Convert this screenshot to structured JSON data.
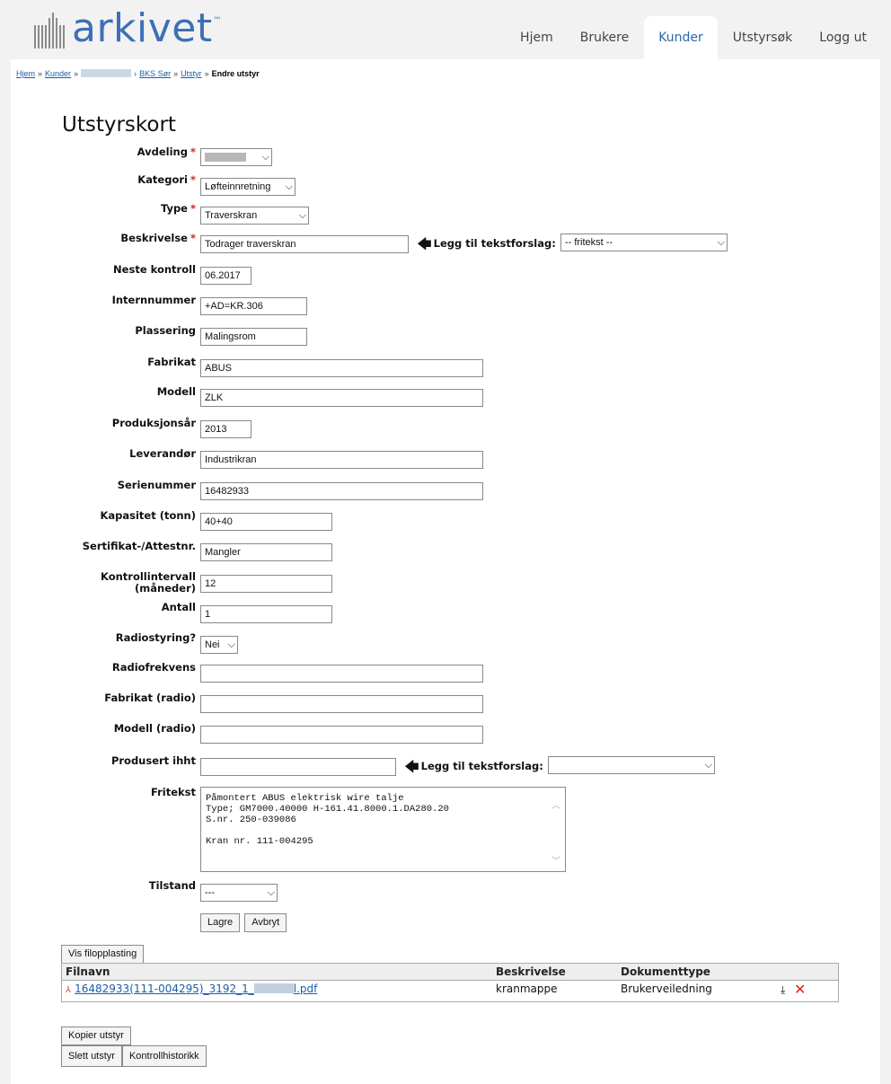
{
  "app": {
    "logo_text": "arkivet",
    "logo_tm": "™"
  },
  "nav": {
    "items": [
      {
        "label": "Hjem"
      },
      {
        "label": "Brukere"
      },
      {
        "label": "Kunder"
      },
      {
        "label": "Utstyrsøk"
      },
      {
        "label": "Logg ut"
      }
    ],
    "active": "Kunder"
  },
  "breadcrumb": {
    "items": [
      "Hjem",
      "Kunder",
      "BKS Sør",
      "Utstyr"
    ],
    "current": "Endre utstyr",
    "separator": "»"
  },
  "page_title": "Utstyrskort",
  "form": {
    "avdeling": {
      "label": "Avdeling",
      "required": "*"
    },
    "kategori": {
      "label": "Kategori",
      "required": "*",
      "value": "Løfteinnretning"
    },
    "type": {
      "label": "Type",
      "required": "*",
      "value": "Traverskran"
    },
    "beskrivelse": {
      "label": "Beskrivelse",
      "required": "*",
      "value": "Todrager traverskran",
      "suggest_label": "Legg til tekstforslag:",
      "suggest_value": "-- fritekst --"
    },
    "neste_kontroll": {
      "label": "Neste kontroll",
      "value": "06.2017"
    },
    "internnummer": {
      "label": "Internnummer",
      "value": "+AD=KR.306"
    },
    "plassering": {
      "label": "Plassering",
      "value": "Malingsrom"
    },
    "fabrikat": {
      "label": "Fabrikat",
      "value": "ABUS"
    },
    "modell": {
      "label": "Modell",
      "value": "ZLK"
    },
    "produksjonsar": {
      "label": "Produksjonsår",
      "value": "2013"
    },
    "leverandor": {
      "label": "Leverandør",
      "value": "Industrikran"
    },
    "serienummer": {
      "label": "Serienummer",
      "value": "16482933"
    },
    "kapasitet": {
      "label": "Kapasitet (tonn)",
      "value": "40+40"
    },
    "sertifikat": {
      "label": "Sertifikat-/Attestnr.",
      "value": "Mangler"
    },
    "kontrollintervall": {
      "label": "Kontrollintervall",
      "label2": "(måneder)",
      "value": "12"
    },
    "antall": {
      "label": "Antall",
      "value": "1"
    },
    "radiostyring": {
      "label": "Radiostyring?",
      "value": "Nei"
    },
    "radiofrekvens": {
      "label": "Radiofrekvens",
      "value": ""
    },
    "fabrikat_radio": {
      "label": "Fabrikat (radio)",
      "value": ""
    },
    "modell_radio": {
      "label": "Modell (radio)",
      "value": ""
    },
    "produsert_ihht": {
      "label": "Produsert ihht",
      "value": "",
      "suggest_label": "Legg til tekstforslag:",
      "suggest_value": ""
    },
    "fritekst": {
      "label": "Fritekst",
      "value": "Påmontert ABUS elektrisk wire talje\nType; GM7000.40000 H-161.41.8000.1.DA280.20\nS.nr. 250-039086\n\nKran nr. 111-004295"
    },
    "tilstand": {
      "label": "Tilstand",
      "value": "---"
    }
  },
  "buttons": {
    "lagre": "Lagre",
    "avbryt": "Avbryt",
    "vis_filopplasting": "Vis filopplasting",
    "kopier_utstyr": "Kopier utstyr",
    "slett_utstyr": "Slett utstyr",
    "kontrollhistorikk": "Kontrollhistorikk"
  },
  "files": {
    "headers": {
      "filnavn": "Filnavn",
      "beskrivelse": "Beskrivelse",
      "dokumenttype": "Dokumenttype"
    },
    "rows": [
      {
        "filnavn_prefix": "16482933(111-004295)_3192_1_",
        "filnavn_suffix": "l.pdf",
        "beskrivelse": "kranmappe",
        "dokumenttype": "Brukerveiledning"
      }
    ]
  },
  "icons": {
    "pdf": "pdf-icon",
    "download": "download-icon",
    "delete": "delete-icon",
    "arrow": "arrow-left-icon"
  },
  "colors": {
    "brand": "#3d6fb6",
    "link": "#1a5ea8",
    "required": "#d42020",
    "delete": "#e02020"
  }
}
